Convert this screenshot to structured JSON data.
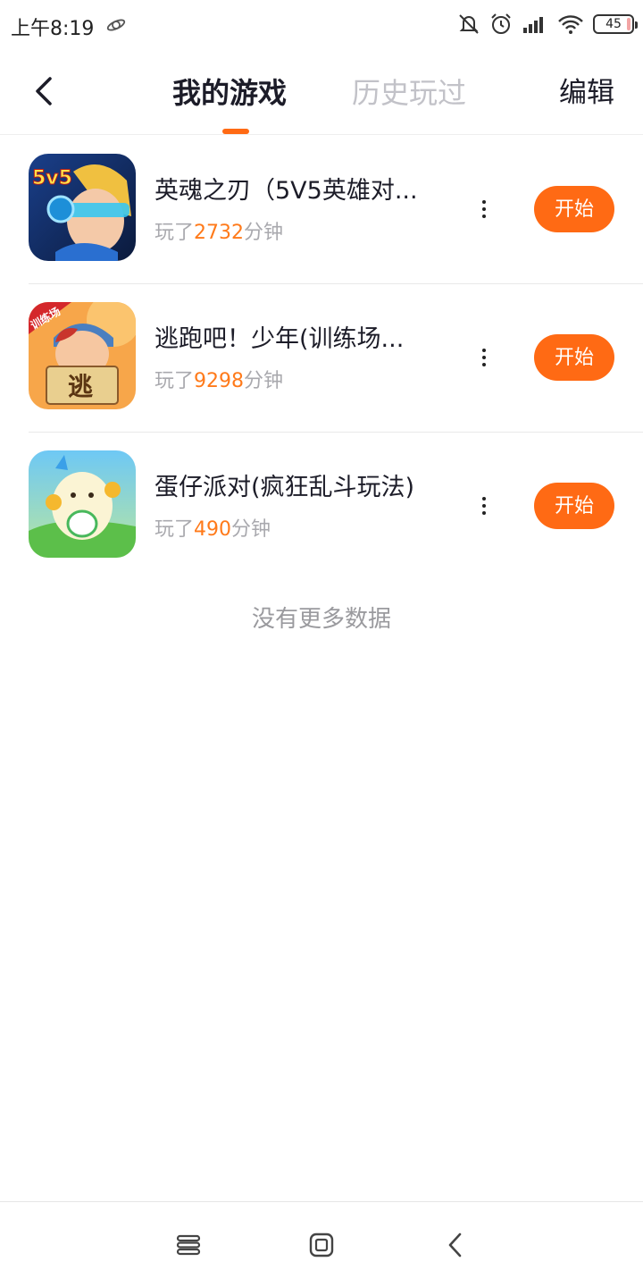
{
  "status_bar": {
    "time": "上午8:19",
    "battery": "45",
    "icons": [
      "app-notification-icon",
      "mute-icon",
      "alarm-icon",
      "signal-icon",
      "wifi-icon",
      "battery-icon"
    ]
  },
  "header": {
    "back_icon": "back-arrow-icon",
    "tabs": [
      {
        "label": "我的游戏",
        "active": true
      },
      {
        "label": "历史玩过",
        "active": false
      }
    ],
    "edit_label": "编辑"
  },
  "games": [
    {
      "name": "英魂之刃（5V5英雄对...",
      "played_prefix": "玩了",
      "minutes": "2732",
      "played_suffix": "分钟",
      "button": "开始",
      "icon": "game-icon-5v5-hero"
    },
    {
      "name": "逃跑吧！少年(训练场...",
      "played_prefix": "玩了",
      "minutes": "9298",
      "played_suffix": "分钟",
      "button": "开始",
      "icon": "game-icon-escape"
    },
    {
      "name": "蛋仔派对(疯狂乱斗玩法)",
      "played_prefix": "玩了",
      "minutes": "490",
      "played_suffix": "分钟",
      "button": "开始",
      "icon": "game-icon-eggy"
    }
  ],
  "no_more_text": "没有更多数据",
  "colors": {
    "accent": "#ff6a14",
    "minutes": "#ff7a1a",
    "inactive_tab": "#c2c2c8"
  },
  "nav_bar": {
    "icons": [
      "menu-icon",
      "home-icon",
      "back-icon"
    ]
  }
}
